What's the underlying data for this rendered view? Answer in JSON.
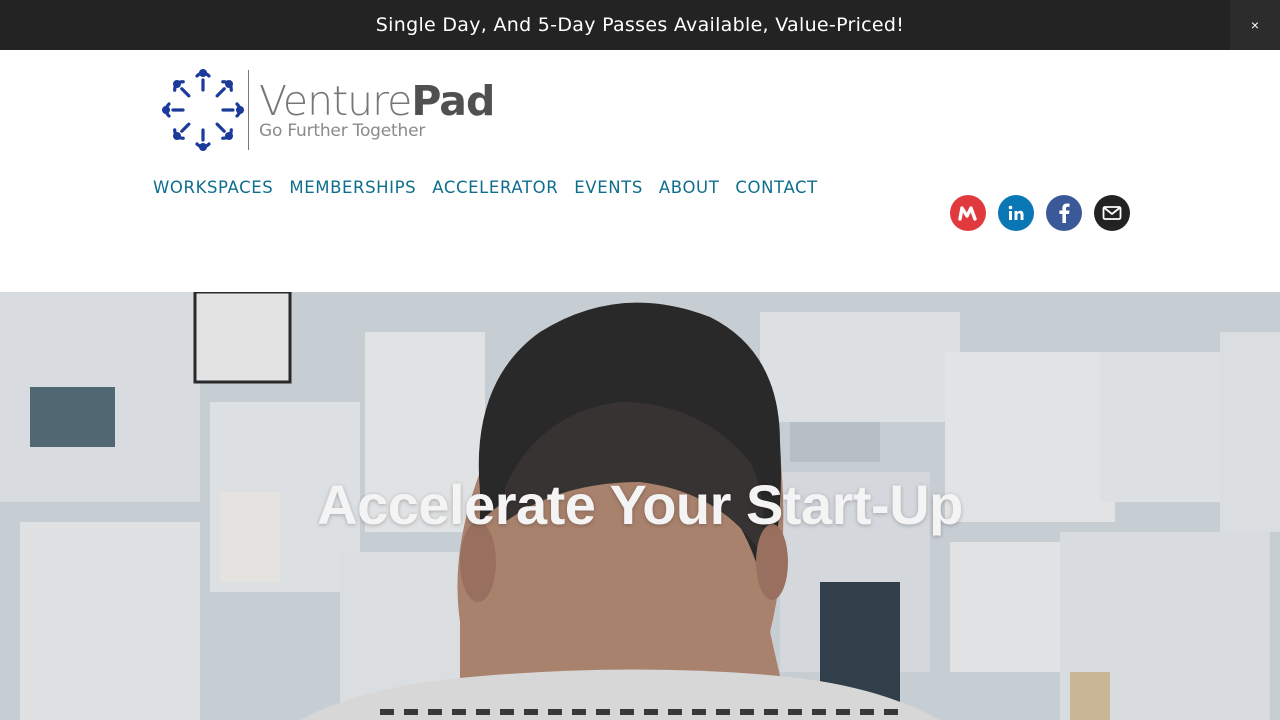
{
  "announcement": {
    "text": "Single Day,  And 5-Day Passes Available, Value-Priced!",
    "close_label": "×"
  },
  "logo": {
    "name_light": "Venture",
    "name_bold": "Pad",
    "tagline": "Go Further Together",
    "mark_color": "#1b3a9a"
  },
  "nav": {
    "items": [
      {
        "label": "WORKSPACES"
      },
      {
        "label": "MEMBERSHIPS"
      },
      {
        "label": "ACCELERATOR"
      },
      {
        "label": "EVENTS"
      },
      {
        "label": "ABOUT"
      },
      {
        "label": "CONTACT"
      }
    ]
  },
  "socials": [
    {
      "icon": "meetup-icon",
      "color": "#e0393e"
    },
    {
      "icon": "linkedin-icon",
      "color": "#0a77b5"
    },
    {
      "icon": "facebook-icon",
      "color": "#3b5998"
    },
    {
      "icon": "email-icon",
      "color": "#222222"
    }
  ],
  "hero": {
    "title": "Accelerate Your Start-Up"
  }
}
